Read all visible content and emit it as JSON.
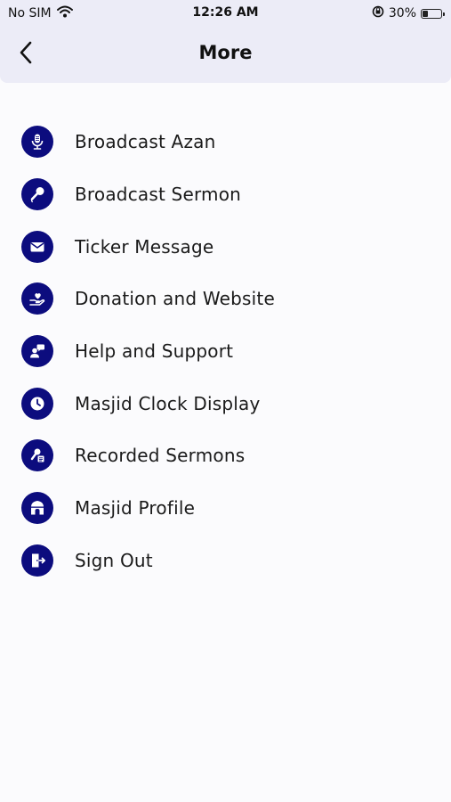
{
  "status_bar": {
    "carrier": "No SIM",
    "time": "12:26 AM",
    "battery_percent": "30%",
    "battery_level": 0.3
  },
  "header": {
    "title": "More"
  },
  "colors": {
    "accent": "#0c0c7e",
    "header_bg": "#ececf7"
  },
  "menu": {
    "items": [
      {
        "label": "Broadcast Azan",
        "icon": "microphone-icon"
      },
      {
        "label": "Broadcast Sermon",
        "icon": "handheld-mic-icon"
      },
      {
        "label": "Ticker Message",
        "icon": "envelope-icon"
      },
      {
        "label": "Donation and Website",
        "icon": "heart-hand-icon"
      },
      {
        "label": "Help and Support",
        "icon": "support-chat-icon"
      },
      {
        "label": "Masjid Clock Display",
        "icon": "clock-icon"
      },
      {
        "label": "Recorded Sermons",
        "icon": "recorded-mic-icon"
      },
      {
        "label": "Masjid Profile",
        "icon": "mosque-icon"
      },
      {
        "label": "Sign Out",
        "icon": "sign-out-icon"
      }
    ]
  }
}
